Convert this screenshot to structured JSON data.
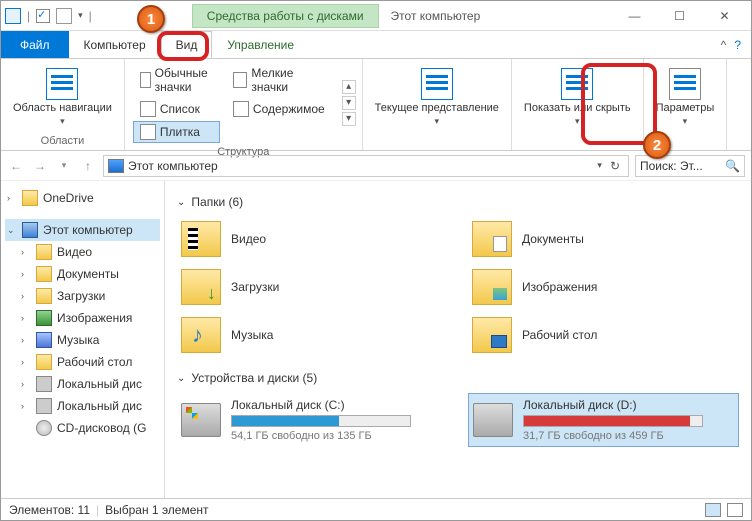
{
  "title": {
    "context": "Средства работы с дисками",
    "window": "Этот компьютер"
  },
  "tabs": {
    "file": "Файл",
    "computer": "Компьютер",
    "view": "Вид",
    "manage": "Управление"
  },
  "ribbon": {
    "nav_panel": "Область навигации",
    "nav_group": "Области",
    "struct": {
      "icons_normal": "Обычные значки",
      "icons_small": "Мелкие значки",
      "list": "Список",
      "content": "Содержимое",
      "tiles": "Плитка",
      "group": "Структура"
    },
    "current": "Текущее представление",
    "show_hide": "Показать или скрыть",
    "options": "Параметры"
  },
  "addr": {
    "location": "Этот компьютер",
    "search_placeholder": "Поиск: Эт..."
  },
  "sidebar": {
    "onedrive": "OneDrive",
    "this_pc": "Этот компьютер",
    "videos": "Видео",
    "documents": "Документы",
    "downloads": "Загрузки",
    "pictures": "Изображения",
    "music": "Музыка",
    "desktop": "Рабочий стол",
    "local_c": "Локальный дис",
    "local_d": "Локальный дис",
    "cd": "CD-дисковод (G"
  },
  "content": {
    "folders_header": "Папки (6)",
    "devices_header": "Устройства и диски (5)",
    "folders": {
      "videos": "Видео",
      "documents": "Документы",
      "downloads": "Загрузки",
      "pictures": "Изображения",
      "music": "Музыка",
      "desktop": "Рабочий стол"
    },
    "drive_c": {
      "name": "Локальный диск (C:)",
      "sub": "54,1 ГБ свободно из 135 ГБ"
    },
    "drive_d": {
      "name": "Локальный диск (D:)",
      "sub": "31,7 ГБ свободно из 459 ГБ"
    }
  },
  "status": {
    "count": "Элементов: 11",
    "selected": "Выбран 1 элемент"
  },
  "badges": {
    "one": "1",
    "two": "2"
  }
}
